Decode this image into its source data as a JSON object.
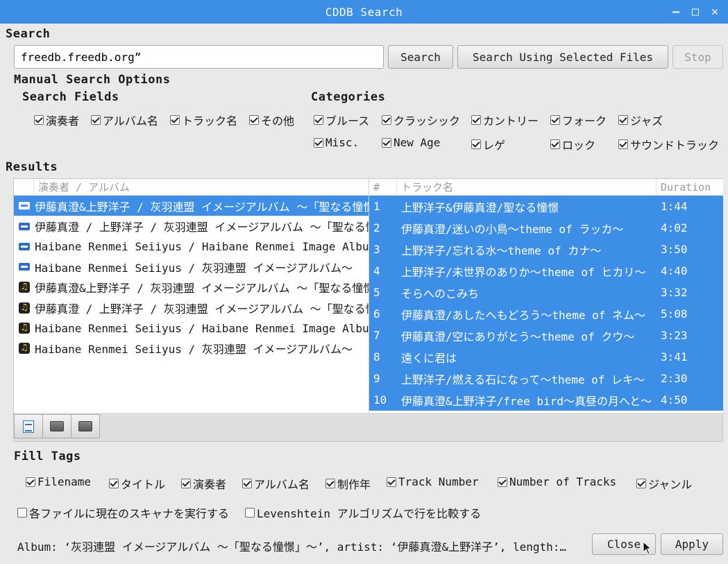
{
  "window": {
    "title": "CDDB Search",
    "minimize": "—",
    "maximize": "□",
    "close": "✕"
  },
  "search": {
    "section_label": "Search",
    "query": "freedb.freedb.org”",
    "search_button": "Search",
    "search_selected_button": "Search Using Selected Files",
    "stop_button": "Stop"
  },
  "manual": {
    "label": "Manual Search Options",
    "fields_label": "Search Fields",
    "fields": [
      {
        "label": "演奏者",
        "checked": true
      },
      {
        "label": "アルバム名",
        "checked": true
      },
      {
        "label": "トラック名",
        "checked": true
      },
      {
        "label": "その他",
        "checked": true
      }
    ],
    "categories_label": "Categories",
    "categories": [
      {
        "label": "ブルース",
        "checked": true
      },
      {
        "label": "クラッシック",
        "checked": true
      },
      {
        "label": "カントリー",
        "checked": true
      },
      {
        "label": "フォーク",
        "checked": true
      },
      {
        "label": "ジャズ",
        "checked": true
      },
      {
        "label": "Misc.",
        "checked": true
      },
      {
        "label": "New Age",
        "checked": true
      },
      {
        "label": "レゲ",
        "checked": true
      },
      {
        "label": "ロック",
        "checked": true
      },
      {
        "label": "サウンドトラック",
        "checked": true
      }
    ]
  },
  "results": {
    "label": "Results",
    "albums_header": "演奏者 / アルバム",
    "albums": [
      {
        "icon": "cd-icon",
        "text": "伊藤真澄&上野洋子 / 灰羽連盟 イメージアルバム 〜「聖なる憧憬」〜",
        "selected": true
      },
      {
        "icon": "cd-icon",
        "text": "伊藤真澄 / 上野洋子 / 灰羽連盟 イメージアルバム 〜「聖なる憧憬」〜",
        "selected": false
      },
      {
        "icon": "cd-icon",
        "text": "Haibane Renmei Seiiyus / Haibane Renmei Image Album",
        "selected": false
      },
      {
        "icon": "cd-icon",
        "text": "Haibane Renmei Seiiyus / 灰羽連盟 イメージアルバム〜",
        "selected": false
      },
      {
        "icon": "music-note-icon",
        "text": "伊藤真澄&上野洋子 / 灰羽連盟 イメージアルバム 〜「聖なる憧憬」〜",
        "selected": false
      },
      {
        "icon": "music-note-icon",
        "text": "伊藤真澄 / 上野洋子 / 灰羽連盟 イメージアルバム 〜「聖なる憧憬」〜",
        "selected": false
      },
      {
        "icon": "music-note-icon",
        "text": "Haibane Renmei Seiiyus / Haibane Renmei Image Album",
        "selected": false
      },
      {
        "icon": "music-note-icon",
        "text": "Haibane Renmei Seiiyus / 灰羽連盟 イメージアルバム〜",
        "selected": false
      }
    ],
    "tracks_header": {
      "num": "#",
      "track": "トラック名",
      "duration": "Duration"
    },
    "tracks": [
      {
        "n": "1",
        "title": "上野洋子&伊藤真澄/聖なる憧憬",
        "duration": "1:44"
      },
      {
        "n": "2",
        "title": "伊藤真澄/迷いの小鳥〜theme of ラッカ〜",
        "duration": "4:02"
      },
      {
        "n": "3",
        "title": "上野洋子/忘れる水〜theme of カナ〜",
        "duration": "3:50"
      },
      {
        "n": "4",
        "title": "上野洋子/未世界のありか〜theme of ヒカリ〜",
        "duration": "4:40"
      },
      {
        "n": "5",
        "title": "そらへのこみち",
        "duration": "3:32"
      },
      {
        "n": "6",
        "title": "伊藤真澄/あしたへもどろう〜theme of ネム〜",
        "duration": "5:08"
      },
      {
        "n": "7",
        "title": "伊藤真澄/空にありがとう〜theme of クウ〜",
        "duration": "3:23"
      },
      {
        "n": "8",
        "title": "遠くに君は",
        "duration": "3:41"
      },
      {
        "n": "9",
        "title": "上野洋子/燃える石になって〜theme of レキ〜",
        "duration": "2:30"
      },
      {
        "n": "10",
        "title": "伊藤真澄&上野洋子/free bird〜真昼の月へと〜",
        "duration": "4:50"
      }
    ]
  },
  "fill": {
    "label": "Fill Tags",
    "tags": [
      {
        "label": "Filename",
        "checked": true
      },
      {
        "label": "タイトル",
        "checked": true
      },
      {
        "label": "演奏者",
        "checked": true
      },
      {
        "label": "アルバム名",
        "checked": true
      },
      {
        "label": "制作年",
        "checked": true
      },
      {
        "label": "Track Number",
        "checked": true
      },
      {
        "label": "Number of Tracks",
        "checked": true
      },
      {
        "label": "ジャンル",
        "checked": true
      }
    ],
    "run_scanner": {
      "label": "各ファイルに現在のスキャナを実行する",
      "checked": false
    },
    "levenshtein": {
      "label": "Levenshtein アルゴリズムで行を比較する",
      "checked": false
    }
  },
  "footer": {
    "status": "Album: ‘灰羽連盟 イメージアルバム 〜「聖なる憧憬」〜’, artist: ‘伊藤真澄&上野洋子’, length:…",
    "close_button": "Close",
    "apply_button": "Apply"
  }
}
